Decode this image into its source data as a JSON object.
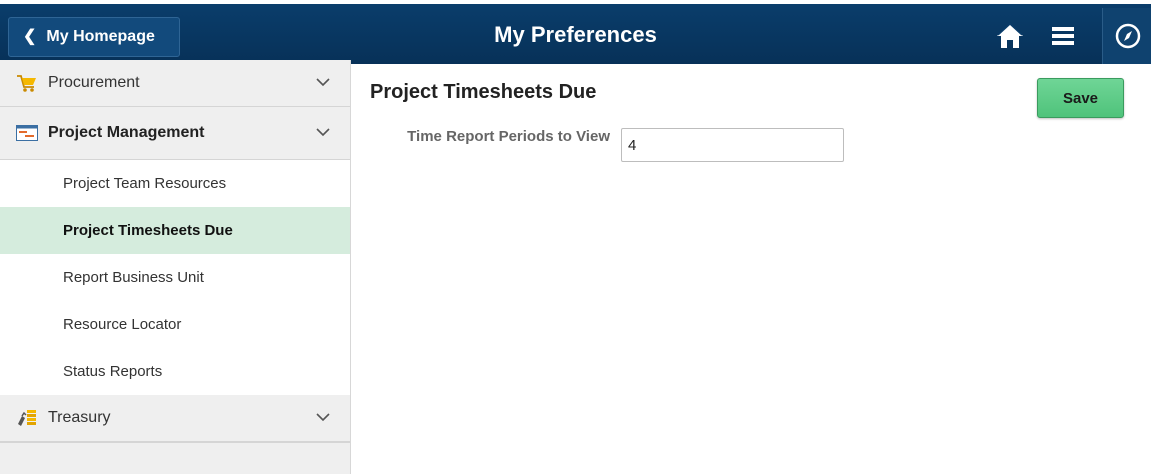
{
  "header": {
    "back_label": "My Homepage",
    "title": "My Preferences",
    "icons": [
      "home-icon",
      "menu-icon",
      "navigator-icon"
    ]
  },
  "sidebar": {
    "categories": [
      {
        "label": "Procurement",
        "icon": "shopping-cart-icon",
        "expanded": false
      },
      {
        "label": "Project Management",
        "icon": "gantt-chart-icon",
        "expanded": true,
        "items": [
          {
            "label": "Project Team Resources",
            "active": false
          },
          {
            "label": "Project Timesheets Due",
            "active": true
          },
          {
            "label": "Report Business Unit",
            "active": false
          },
          {
            "label": "Resource Locator",
            "active": false
          },
          {
            "label": "Status Reports",
            "active": false
          }
        ]
      },
      {
        "label": "Treasury",
        "icon": "treasury-coins-icon",
        "expanded": false
      }
    ]
  },
  "main": {
    "title": "Project Timesheets Due",
    "save_label": "Save",
    "field_label": "Time Report Periods to View",
    "field_value": "4"
  },
  "colors": {
    "header_bg": "#0a3d6b",
    "active_item_bg": "#d5ecdd",
    "save_bg": "#5ccb86"
  }
}
